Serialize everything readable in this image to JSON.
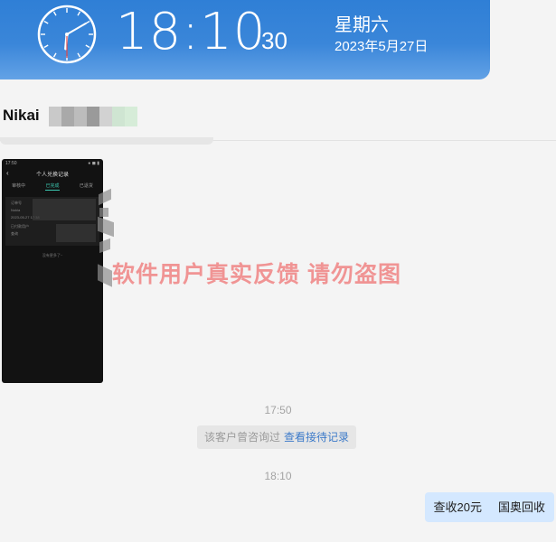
{
  "clock": {
    "time": "18:10",
    "seconds": "30",
    "weekday": "星期六",
    "date": "2023年5月27日",
    "hour_hand_deg": 185,
    "minute_hand_deg": 60,
    "second_hand_deg": 180
  },
  "chat": {
    "contact_name": "Nikai",
    "screenshot": {
      "status_left": "17:50",
      "status_right": "● ◼ ▮",
      "back_glyph": "‹",
      "title": "个人兑换记录",
      "tabs": [
        "审核中",
        "已完成",
        "已退货"
      ],
      "active_tab_index": 1,
      "card_lines": [
        "订单号",
        "Nokia",
        "2023-05-27 17:38",
        "已付款用户",
        "查询"
      ],
      "empty_text": "没有更多了~"
    },
    "watermark": "软件用户真实反馈  请勿盗图",
    "messages": [
      {
        "type": "time",
        "text": "17:50"
      },
      {
        "type": "notice",
        "text": "该客户曾咨询过",
        "link": "查看接待记录"
      },
      {
        "type": "time",
        "text": "18:10"
      },
      {
        "type": "outgoing",
        "parts": [
          "查收20元",
          "国奥回收"
        ]
      }
    ]
  },
  "colors": {
    "banner": "#3a86d9",
    "watermark": "#f08c8c",
    "notice_link": "#3c7ac9",
    "outgoing_bubble": "#d4e8ff",
    "screenshot_accent": "#3bc7b0"
  }
}
